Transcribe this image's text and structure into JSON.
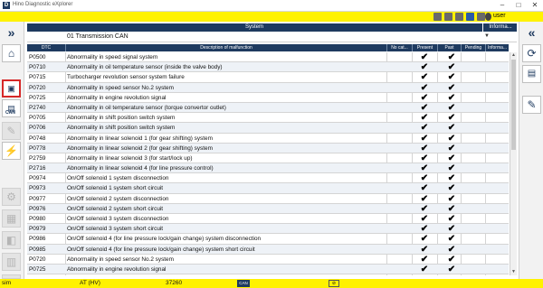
{
  "window": {
    "title": "Hino Diagnostic eXplorer",
    "icon_letter": "D"
  },
  "toolbar": {
    "user": "user"
  },
  "system_panel": {
    "header": "System",
    "info_header": "Informa...",
    "value": "01  Transmission  CAN"
  },
  "grid": {
    "columns": {
      "dtc": "DTC",
      "description": "Description of malfunction",
      "no_cat": "No cat...",
      "present": "Present",
      "past": "Past",
      "pending": "Pending",
      "info": "Informa..."
    },
    "rows": [
      {
        "dtc": "P0500",
        "desc": "Abnormality in speed signal system",
        "present": "✔",
        "past": "✔"
      },
      {
        "dtc": "P0710",
        "desc": "Abnormality in oil temperature sensor (inside the valve body)",
        "present": "✔",
        "past": "✔"
      },
      {
        "dtc": "P0715",
        "desc": "Turbocharger revolution sensor system failure",
        "present": "✔",
        "past": "✔"
      },
      {
        "dtc": "P0720",
        "desc": "Abnormality in speed sensor No.2 system",
        "present": "✔",
        "past": "✔"
      },
      {
        "dtc": "P0725",
        "desc": "Abnormality in engine revolution signal",
        "present": "✔",
        "past": "✔"
      },
      {
        "dtc": "P2740",
        "desc": "Abnormality in oil temperature sensor (torque convertor outlet)",
        "present": "✔",
        "past": "✔"
      },
      {
        "dtc": "P0705",
        "desc": "Abnormality in shift position switch system",
        "present": "✔",
        "past": "✔"
      },
      {
        "dtc": "P0706",
        "desc": "Abnormality in shift position switch system",
        "present": "✔",
        "past": "✔"
      },
      {
        "dtc": "P0748",
        "desc": "Abnormality in linear solenoid 1 (for  gear shifting) system",
        "present": "✔",
        "past": "✔"
      },
      {
        "dtc": "P0778",
        "desc": "Abnormality in linear solenoid 2 (for  gear shifting) system",
        "present": "✔",
        "past": "✔"
      },
      {
        "dtc": "P2759",
        "desc": "Abnormality in linear solenoid 3 (for  start/lock up)",
        "present": "✔",
        "past": "✔"
      },
      {
        "dtc": "P2716",
        "desc": "Abnormality in linear solenoid 4 (for line pressure control)",
        "present": "✔",
        "past": "✔"
      },
      {
        "dtc": "P0974",
        "desc": "On/Off solenoid 1 system disconnection",
        "present": "✔",
        "past": "✔"
      },
      {
        "dtc": "P0973",
        "desc": "On/Off solenoid 1 system short circuit",
        "present": "✔",
        "past": "✔"
      },
      {
        "dtc": "P0977",
        "desc": "On/Off solenoid 2 system disconnection",
        "present": "✔",
        "past": "✔"
      },
      {
        "dtc": "P0976",
        "desc": "On/Off solenoid 2 system short circuit",
        "present": "✔",
        "past": "✔"
      },
      {
        "dtc": "P0980",
        "desc": "On/Off solenoid 3 system disconnection",
        "present": "✔",
        "past": "✔"
      },
      {
        "dtc": "P0979",
        "desc": "On/Off solenoid 3 system short circuit",
        "present": "✔",
        "past": "✔"
      },
      {
        "dtc": "P0986",
        "desc": "On/Off solenoid 4 (for line pressure lock/gain change) system disconnection",
        "present": "✔",
        "past": "✔"
      },
      {
        "dtc": "P0985",
        "desc": "On/Off solenoid 4 (for line pressure lock/gain change) system short circuit",
        "present": "✔",
        "past": "✔"
      },
      {
        "dtc": "P0720",
        "desc": "Abnormality in speed sensor No.2 system",
        "present": "✔",
        "past": "✔"
      },
      {
        "dtc": "P0725",
        "desc": "Abnormality in engine revolution signal",
        "present": "✔",
        "past": "✔"
      }
    ]
  },
  "statusbar": {
    "mode_left": "sim",
    "mode": "AT (HV)",
    "code": "37260",
    "can_badge": "CAN",
    "link_badge": "⊘"
  },
  "icons": {
    "left": [
      "chevrons-right-icon",
      "home-icon",
      "dtc-icon",
      "can-icon",
      "tool-icon",
      "monitor-icon",
      "settings-icon",
      "lock-icon",
      "plug-icon",
      "data-icon",
      "clear-icon"
    ],
    "right": [
      "chevrons-left-icon",
      "rotate-icon",
      "print-icon",
      "edit-icon"
    ]
  }
}
